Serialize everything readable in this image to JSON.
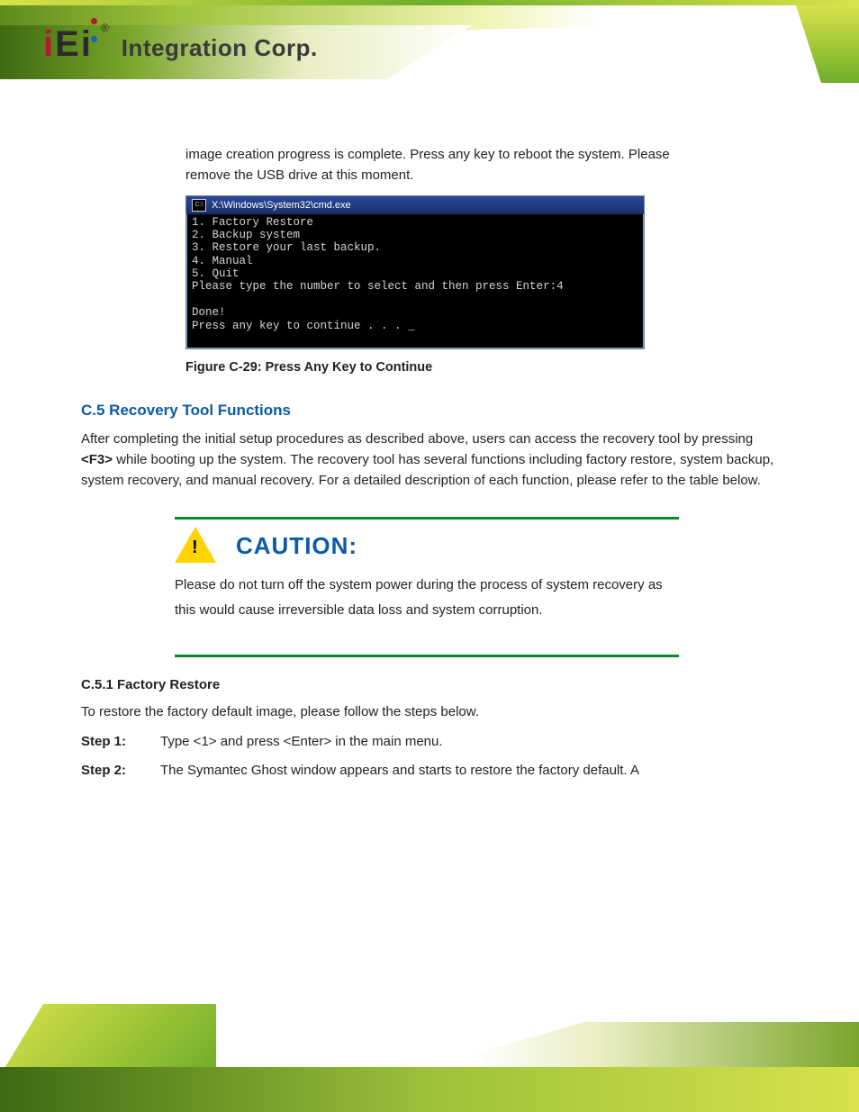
{
  "logo": {
    "brand_i1": "i",
    "brand_e": "E",
    "brand_i2": "i",
    "reg": "®",
    "text": "Integration Corp."
  },
  "intro": "image creation progress is complete. Press any key to reboot the system. Please remove the USB drive at this moment.",
  "cmd": {
    "title": "X:\\Windows\\System32\\cmd.exe",
    "lines": [
      "1. Factory Restore",
      "2. Backup system",
      "3. Restore your last backup.",
      "4. Manual",
      "5. Quit",
      "Please type the number to select and then press Enter:4",
      "",
      "Done!",
      "Press any key to continue . . . _"
    ]
  },
  "caption": "Figure C-29: Press Any Key to Continue",
  "section_heads": {
    "h1": "C.5 Recovery Tool Functions",
    "h2": "C.5.1 Factory Restore"
  },
  "callout": {
    "title": "CAUTION:",
    "body": "Please do not turn off the system power during the process of system recovery as this would cause irreversible data loss and system corruption."
  },
  "p1": "After completing the initial setup procedures as described above, users can access the recovery tool by pressing ",
  "p1_key": "<F3>",
  "p1_cont": " while booting up the system. The recovery tool has several functions including factory restore, system backup, system recovery, and manual recovery. For a detailed description of each function, please refer to the table below.",
  "p2": "To restore the factory default image, please follow the steps below.",
  "steps": [
    {
      "label": "Step 1:",
      "text": "Type <1> and press <Enter> in the main menu."
    },
    {
      "label": "Step 2:",
      "text": "The Symantec Ghost window appears and starts to restore the factory default. A"
    }
  ]
}
